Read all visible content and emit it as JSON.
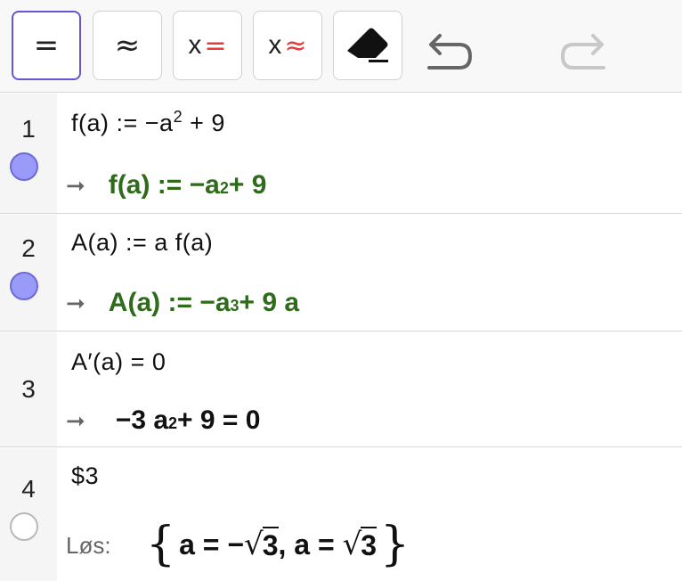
{
  "toolbar": {
    "buttons": [
      {
        "name": "exact-mode",
        "symbol": "=",
        "selected": true
      },
      {
        "name": "numeric-mode",
        "symbol": "≈",
        "selected": false
      },
      {
        "name": "substitute-exact",
        "x": "x",
        "symbol": "=",
        "selected": false
      },
      {
        "name": "substitute-numeric",
        "x": "x",
        "symbol": "≈",
        "selected": false
      },
      {
        "name": "eraser",
        "icon": "eraser-icon",
        "selected": false
      }
    ],
    "undo_icon": "undo-icon",
    "redo_icon": "redo-icon",
    "accent_color": "#6557d2",
    "substitute_color": "#e03c3c"
  },
  "rows": [
    {
      "number": "1",
      "input": "f(a) := −a",
      "input_exp": "2",
      "input_tail": " + 9",
      "output_lhs": "f(a) := −a",
      "output_exp": "2",
      "output_tail": " + 9",
      "output_color": "#2e6b1a",
      "marker": "filled"
    },
    {
      "number": "2",
      "input": "A(a) := a f(a)",
      "output_lhs": "A(a) := −a",
      "output_exp": "3",
      "output_tail": " + 9 a",
      "output_color": "#2e6b1a",
      "marker": "filled"
    },
    {
      "number": "3",
      "input": "A′(a) = 0",
      "output_lhs": "−3 a",
      "output_exp": "2",
      "output_tail": " + 9 = 0",
      "output_color": "#111111",
      "marker": "none"
    },
    {
      "number": "4",
      "input": "$3",
      "command_label": "Løs:",
      "solution": {
        "open": "{",
        "a1": "a = −",
        "r1": "3",
        "sep": ", ",
        "a2": "a = ",
        "r2": "3",
        "close": "}"
      },
      "marker": "empty"
    }
  ],
  "marker_colors": {
    "filled": "#9a9afa",
    "empty": "#ffffff"
  }
}
